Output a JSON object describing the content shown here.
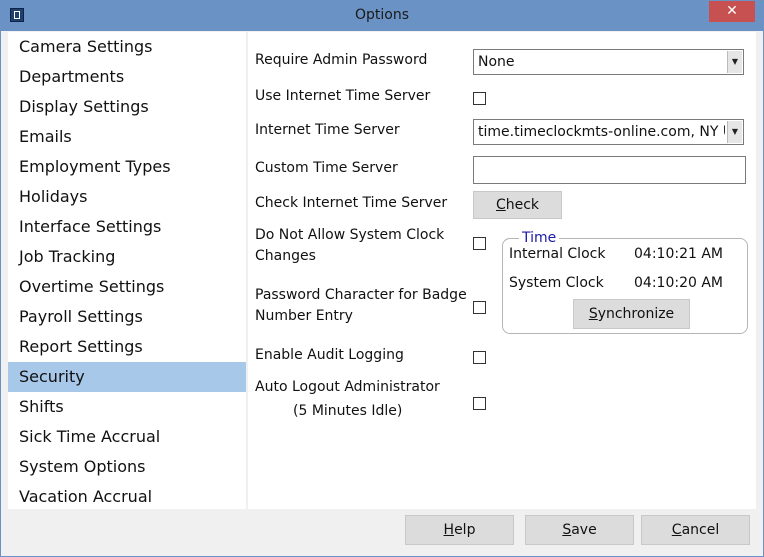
{
  "window": {
    "title": "Options",
    "close_glyph": "✕"
  },
  "sidebar": {
    "items": [
      "Camera Settings",
      "Departments",
      "Display Settings",
      "Emails",
      "Employment Types",
      "Holidays",
      "Interface Settings",
      "Job Tracking",
      "Overtime Settings",
      "Payroll Settings",
      "Report Settings",
      "Security",
      "Shifts",
      "Sick Time Accrual",
      "System Options",
      "Vacation Accrual"
    ],
    "selected": "Security"
  },
  "security": {
    "require_admin_password": {
      "label": "Require Admin Password",
      "value": "None"
    },
    "use_internet_time_server": {
      "label": "Use Internet Time Server"
    },
    "internet_time_server": {
      "label": "Internet Time Server",
      "value": "time.timeclockmts-online.com, NY USA"
    },
    "custom_time_server": {
      "label": "Custom Time Server",
      "value": ""
    },
    "check_internet_time_server": {
      "label": "Check Internet Time Server",
      "button_underlined": "C",
      "button_rest": "heck"
    },
    "do_not_allow_clock_changes": {
      "label_line1": "Do Not Allow System Clock",
      "label_line2": "Changes"
    },
    "password_char_badge": {
      "label_line1": "Password Character for Badge",
      "label_line2": "Number Entry"
    },
    "enable_audit_logging": {
      "label": "Enable Audit Logging"
    },
    "auto_logout_admin": {
      "label_line1": "Auto Logout Administrator",
      "label_line2": "(5 Minutes Idle)"
    }
  },
  "time_group": {
    "legend": "Time",
    "internal_clock_label": "Internal Clock",
    "internal_clock_value": "04:10:21 AM",
    "system_clock_label": "System Clock",
    "system_clock_value": "04:10:20 AM",
    "sync_underlined": "S",
    "sync_rest": "ynchronize"
  },
  "footer": {
    "help_underlined": "H",
    "help_rest": "elp",
    "save_underlined": "S",
    "save_rest": "ave",
    "cancel_underlined": "C",
    "cancel_rest": "ancel"
  },
  "colors": {
    "titlebar": "#6a92c4",
    "selected_item": "#a7c8e9",
    "close_button": "#c75050",
    "group_legend": "#1a1aa6"
  },
  "icons": {
    "dropdown": "▼"
  }
}
